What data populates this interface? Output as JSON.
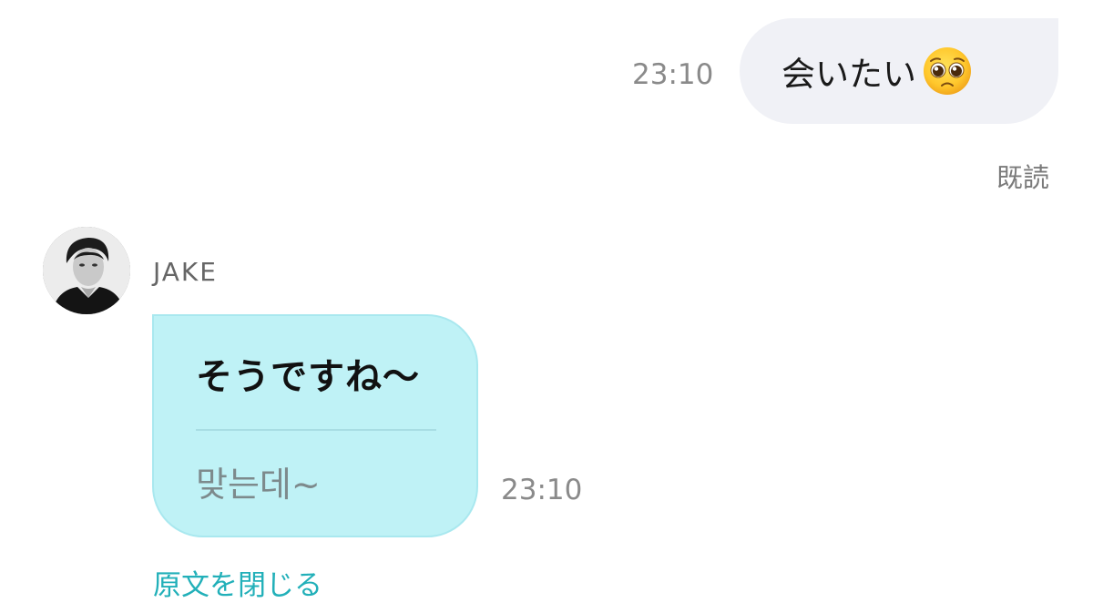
{
  "outgoing": {
    "text": "会いたい",
    "emoji": "pleading-face-emoji",
    "time": "23:10",
    "read_status": "既読"
  },
  "incoming": {
    "sender": "JAKE",
    "translated_text": "そうですね〜",
    "original_text": "맞는데~",
    "time": "23:10"
  },
  "actions": {
    "close_original": "原文を閉じる"
  },
  "colors": {
    "outgoing_bubble": "#f0f1f6",
    "incoming_bubble": "#bff2f6",
    "link_accent": "#22b0b9",
    "timestamp": "#8a8a8a"
  }
}
